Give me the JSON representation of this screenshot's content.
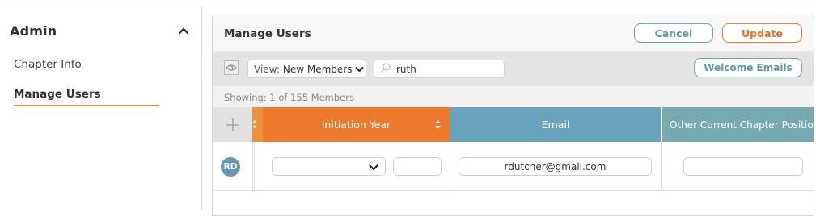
{
  "sidebar": {
    "title": "Admin",
    "items": [
      {
        "label": "Chapter Info"
      },
      {
        "label": "Manage Users"
      }
    ]
  },
  "header": {
    "title": "Manage Users",
    "cancel_label": "Cancel",
    "update_label": "Update"
  },
  "toolbar": {
    "view_prefix": "View:",
    "view_value": "New Members",
    "search_value": "ruth",
    "welcome_label": "Welcome Emails"
  },
  "showing_text": "Showing: 1 of 155 Members",
  "table": {
    "columns": [
      "Initiation Year",
      "Email",
      "Other Current Chapter Positions"
    ],
    "rows": [
      {
        "initials": "RD",
        "email": "rdutcher@gmail.com"
      }
    ]
  },
  "colors": {
    "accent_orange": "#f07a2c",
    "accent_teal": "#6aa7ad",
    "email_header": "#6aa3bd"
  },
  "icons": [
    "chevron-up-icon",
    "eye-icon",
    "search-icon",
    "plus-icon",
    "sort-icon",
    "chevron-down-icon"
  ]
}
